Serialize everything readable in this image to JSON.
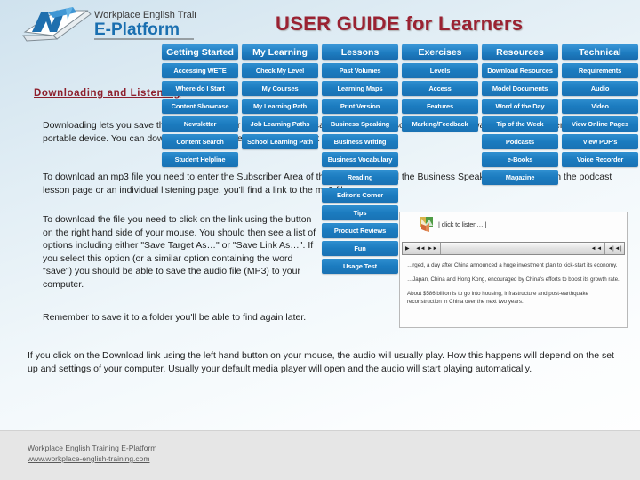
{
  "header": {
    "logo_line1": "Workplace English Training",
    "logo_line2": "E-Platform",
    "title": "USER GUIDE for Learners",
    "title_color": "#9a2232"
  },
  "nav": {
    "accent_color": "#1b7bbf",
    "columns": [
      {
        "header": "Getting Started",
        "items": [
          "Accessing WETE",
          "Where do I Start",
          "Content Showcase",
          "Newsletter",
          "Content Search",
          "Student Helpline"
        ]
      },
      {
        "header": "My Learning",
        "items": [
          "Check My Level",
          "My Courses",
          "My Learning Path",
          "Job Learning Paths",
          "School Learning Path"
        ]
      },
      {
        "header": "Lessons",
        "items": [
          "Past Volumes",
          "Learning Maps",
          "Print Version",
          "Business Speaking",
          "Business Writing",
          "Business Vocabulary",
          "Reading",
          "Editor's Corner",
          "Tips",
          "Product Reviews",
          "Fun",
          "Usage Test"
        ]
      },
      {
        "header": "Exercises",
        "items": [
          "Levels",
          "Access",
          "Features",
          "Marking/Feedback"
        ]
      },
      {
        "header": "Resources",
        "items": [
          "Download Resources",
          "Model Documents",
          "Word of the Day",
          "Tip of the Week",
          "Podcasts",
          "e-Books",
          "Magazine"
        ]
      },
      {
        "header": "Technical",
        "items": [
          "Requirements",
          "Audio",
          "Video",
          "View Online Pages",
          "View PDF's",
          "Voice Recorder"
        ]
      }
    ]
  },
  "content": {
    "heading": "Downloading and Listening",
    "paragraphs": [
      "Downloading lets you save the audio file to your computer so you can listen to the lesson whenever you want, or even transfer it to your portable device. You can download the audio files from the podcast lessons page.",
      "To download an mp3 file you need to enter the Subscriber Area of the website and find the Business Speaking Skills topic. On the podcast lesson page or an individual listening page, you'll find a link to the mp3 file.",
      "To download the file you need to click on the link using the button on the right hand side of your mouse. You should then see a list of options including either \"Save Target As…\" or \"Save Link As…\". If you select this option (or a similar option containing the word \"save\") you should be able to save the audio file (MP3) to your computer.",
      "Remember to save it to a folder you'll be able to find again later.",
      "If you click on the Download link using the left hand button on your mouse, the audio will usually play. How this happens will depend on the set up and settings of your computer. Usually your default media player will open and the audio will start playing automatically."
    ]
  },
  "inset": {
    "listen_label": "| click to listen… |",
    "player": {
      "play_glyph": "▶",
      "rewind_glyph": "◄◄",
      "forward_glyph": "►►",
      "right_glyphs": "◄ ◄",
      "volume_glyphs": "◄| ◄ |"
    },
    "article_paragraphs": [
      "…rged, a day after China announced a huge investment plan to kick-start its economy.",
      "…Japan, China and Hong Kong, encouraged by China's efforts to boost its growth rate.",
      "About $586 billion is to go into housing, infrastructure and post-earthquake reconstruction in China over the next two years."
    ]
  },
  "footer": {
    "line1": "Workplace English Training E-Platform",
    "line2": "www.workplace-english-training.com"
  }
}
